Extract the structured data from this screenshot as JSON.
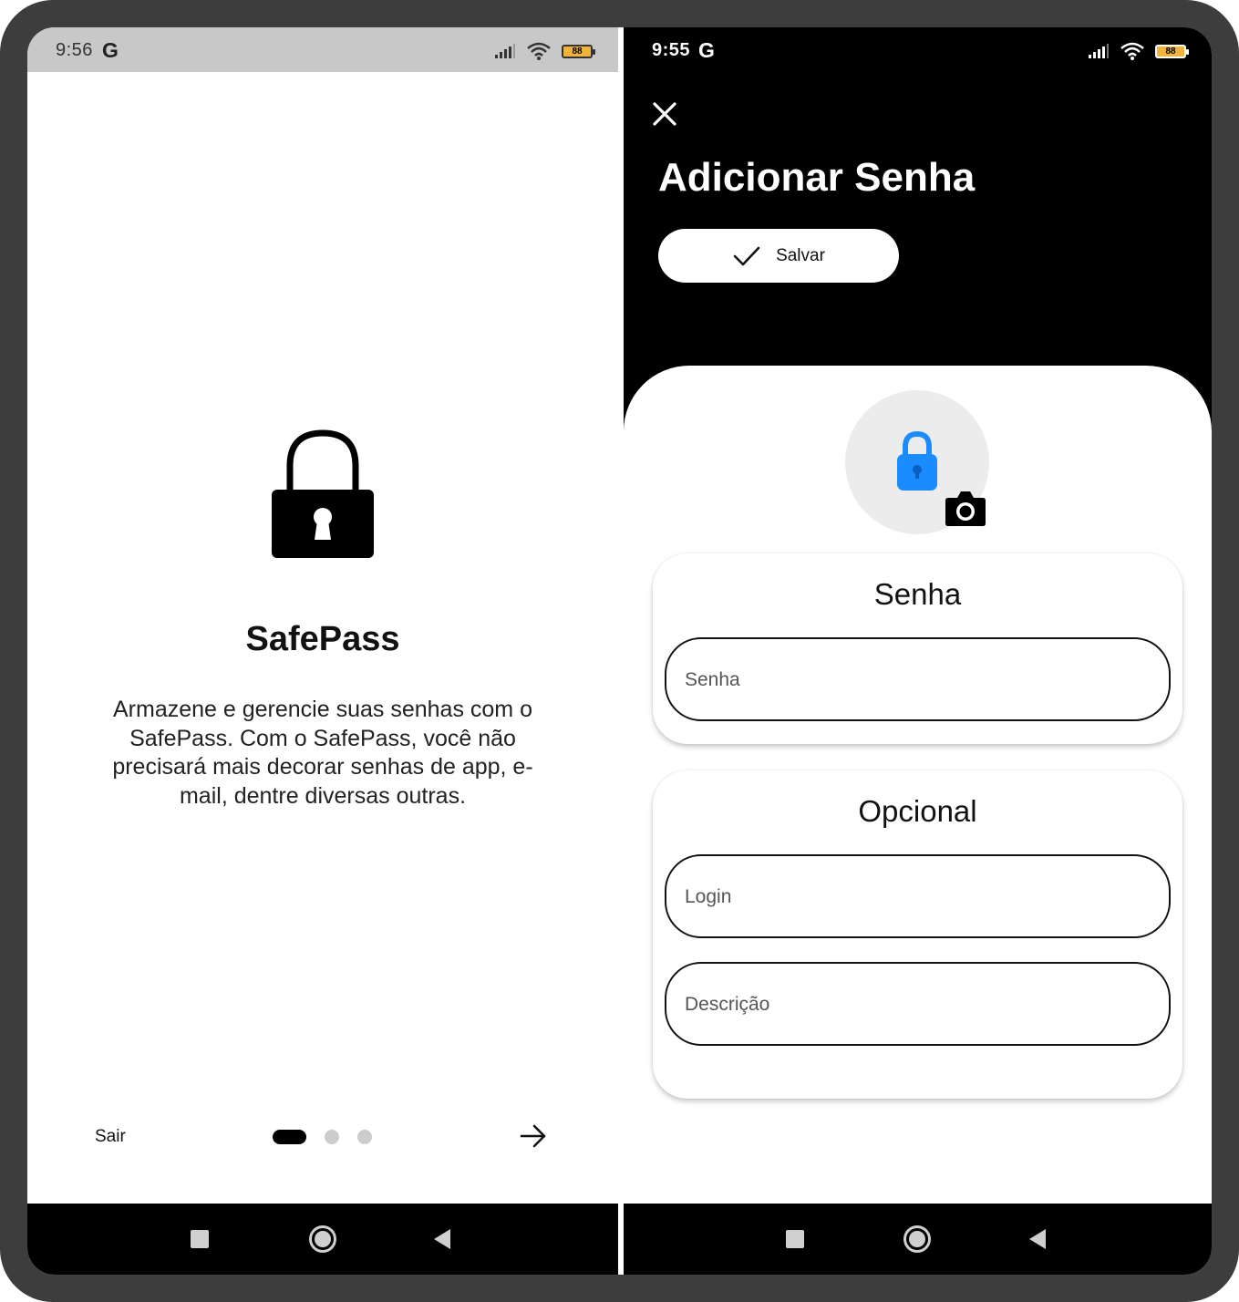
{
  "left_screen": {
    "status": {
      "time": "9:56",
      "carrier_glyph": "G",
      "battery": "88",
      "icons": [
        "signal-icon",
        "wifi-icon",
        "battery-icon"
      ]
    },
    "lock_icon": "lock-icon",
    "title": "SafePass",
    "description": "Armazene e gerencie suas senhas com o SafePass. Com o SafePass, você não precisará mais decorar senhas de app, e-mail, dentre diversas outras.",
    "exit_label": "Sair",
    "pager": {
      "pages": 3,
      "current": 1
    },
    "next_icon": "arrow-right-icon"
  },
  "right_screen": {
    "status": {
      "time": "9:55",
      "carrier_glyph": "G",
      "battery": "88",
      "icons": [
        "signal-icon",
        "wifi-icon",
        "battery-icon"
      ]
    },
    "close_icon": "close-icon",
    "title": "Adicionar Senha",
    "save_button": {
      "label": "Salvar",
      "icon": "check-icon"
    },
    "avatar": {
      "icon": "lock-icon",
      "color": "#1a8cff",
      "camera_icon": "camera-icon"
    },
    "password_card": {
      "title": "Senha",
      "field_placeholder": "Senha"
    },
    "optional_card": {
      "title": "Opcional",
      "login_placeholder": "Login",
      "description_placeholder": "Descrição"
    }
  },
  "nav_bar": {
    "icons": [
      "recents-square-icon",
      "home-circle-icon",
      "back-triangle-icon"
    ]
  },
  "colors": {
    "accent": "#1a8cff",
    "dark": "#000000",
    "frame": "#3d3d3d"
  }
}
